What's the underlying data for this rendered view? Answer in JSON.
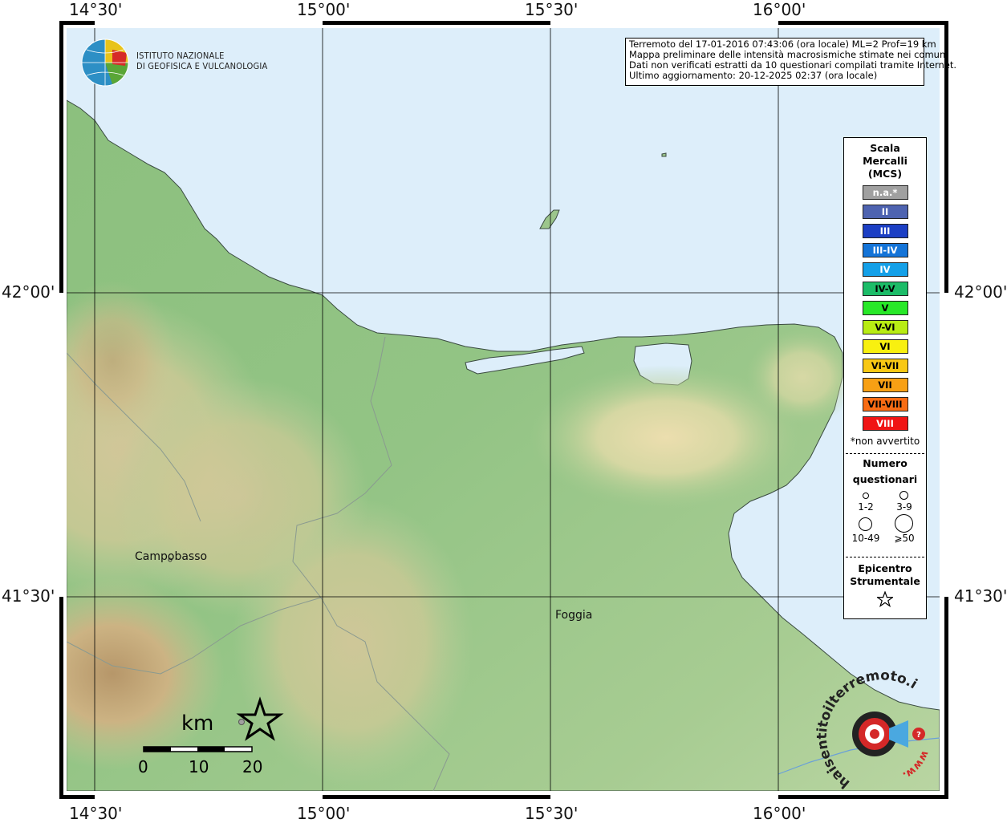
{
  "logo": {
    "line1": "ISTITUTO NAZIONALE",
    "line2": "DI GEOFISICA E VULCANOLOGIA"
  },
  "axes": {
    "lon_labels": [
      "14°30'",
      "15°00'",
      "15°30'",
      "16°00'"
    ],
    "lat_labels": [
      "42°00'",
      "41°30'"
    ]
  },
  "info": {
    "line1": "Terremoto del 17-01-2016 07:43:06 (ora locale) ML=2 Prof=19 km",
    "line2": "Mappa preliminare delle intensità macrosismiche stimate nei comuni",
    "line3": "Dati non verificati estratti da 10 questionari compilati tramite Internet.",
    "line4": "Ultimo aggiornamento: 20-12-2025 02:37 (ora locale)"
  },
  "legend": {
    "title_lines": [
      "Scala",
      "Mercalli",
      "(MCS)"
    ],
    "scale": [
      {
        "label": "n.a.*",
        "color": "#a0a0a0",
        "text_color": "#ffffff"
      },
      {
        "label": "II",
        "color": "#4e63b0",
        "text_color": "#ffffff"
      },
      {
        "label": "III",
        "color": "#1c3fc4",
        "text_color": "#ffffff"
      },
      {
        "label": "III-IV",
        "color": "#1474d8",
        "text_color": "#ffffff"
      },
      {
        "label": "IV",
        "color": "#14a0e8",
        "text_color": "#ffffff"
      },
      {
        "label": "IV-V",
        "color": "#1cbc68",
        "text_color": "#000000"
      },
      {
        "label": "V",
        "color": "#28e828",
        "text_color": "#000000"
      },
      {
        "label": "V-VI",
        "color": "#b8ec14",
        "text_color": "#000000"
      },
      {
        "label": "VI",
        "color": "#f8f010",
        "text_color": "#000000"
      },
      {
        "label": "VI-VII",
        "color": "#f8c814",
        "text_color": "#000000"
      },
      {
        "label": "VII",
        "color": "#f8a014",
        "text_color": "#000000"
      },
      {
        "label": "VII-VIII",
        "color": "#f86c14",
        "text_color": "#000000"
      },
      {
        "label": "VIII",
        "color": "#f01414",
        "text_color": "#ffffff"
      }
    ],
    "note": "*non avvertito",
    "count_title_lines": [
      "Numero",
      "questionari"
    ],
    "counts": [
      "1-2",
      "3-9",
      "10-49",
      "⩾50"
    ],
    "epicenter_title_lines": [
      "Epicentro",
      "Strumentale"
    ],
    "epicenter_icon": "star-icon"
  },
  "places": [
    {
      "name": "Campobasso"
    },
    {
      "name": "Foggia"
    }
  ],
  "scale_bar": {
    "unit": "km",
    "ticks": [
      "0",
      "10",
      "20"
    ]
  },
  "watermark": {
    "text": "haisentitoilterremoto.it",
    "url_text": "www."
  },
  "colors": {
    "sea": "#ddeefa",
    "frame": "#000000"
  }
}
